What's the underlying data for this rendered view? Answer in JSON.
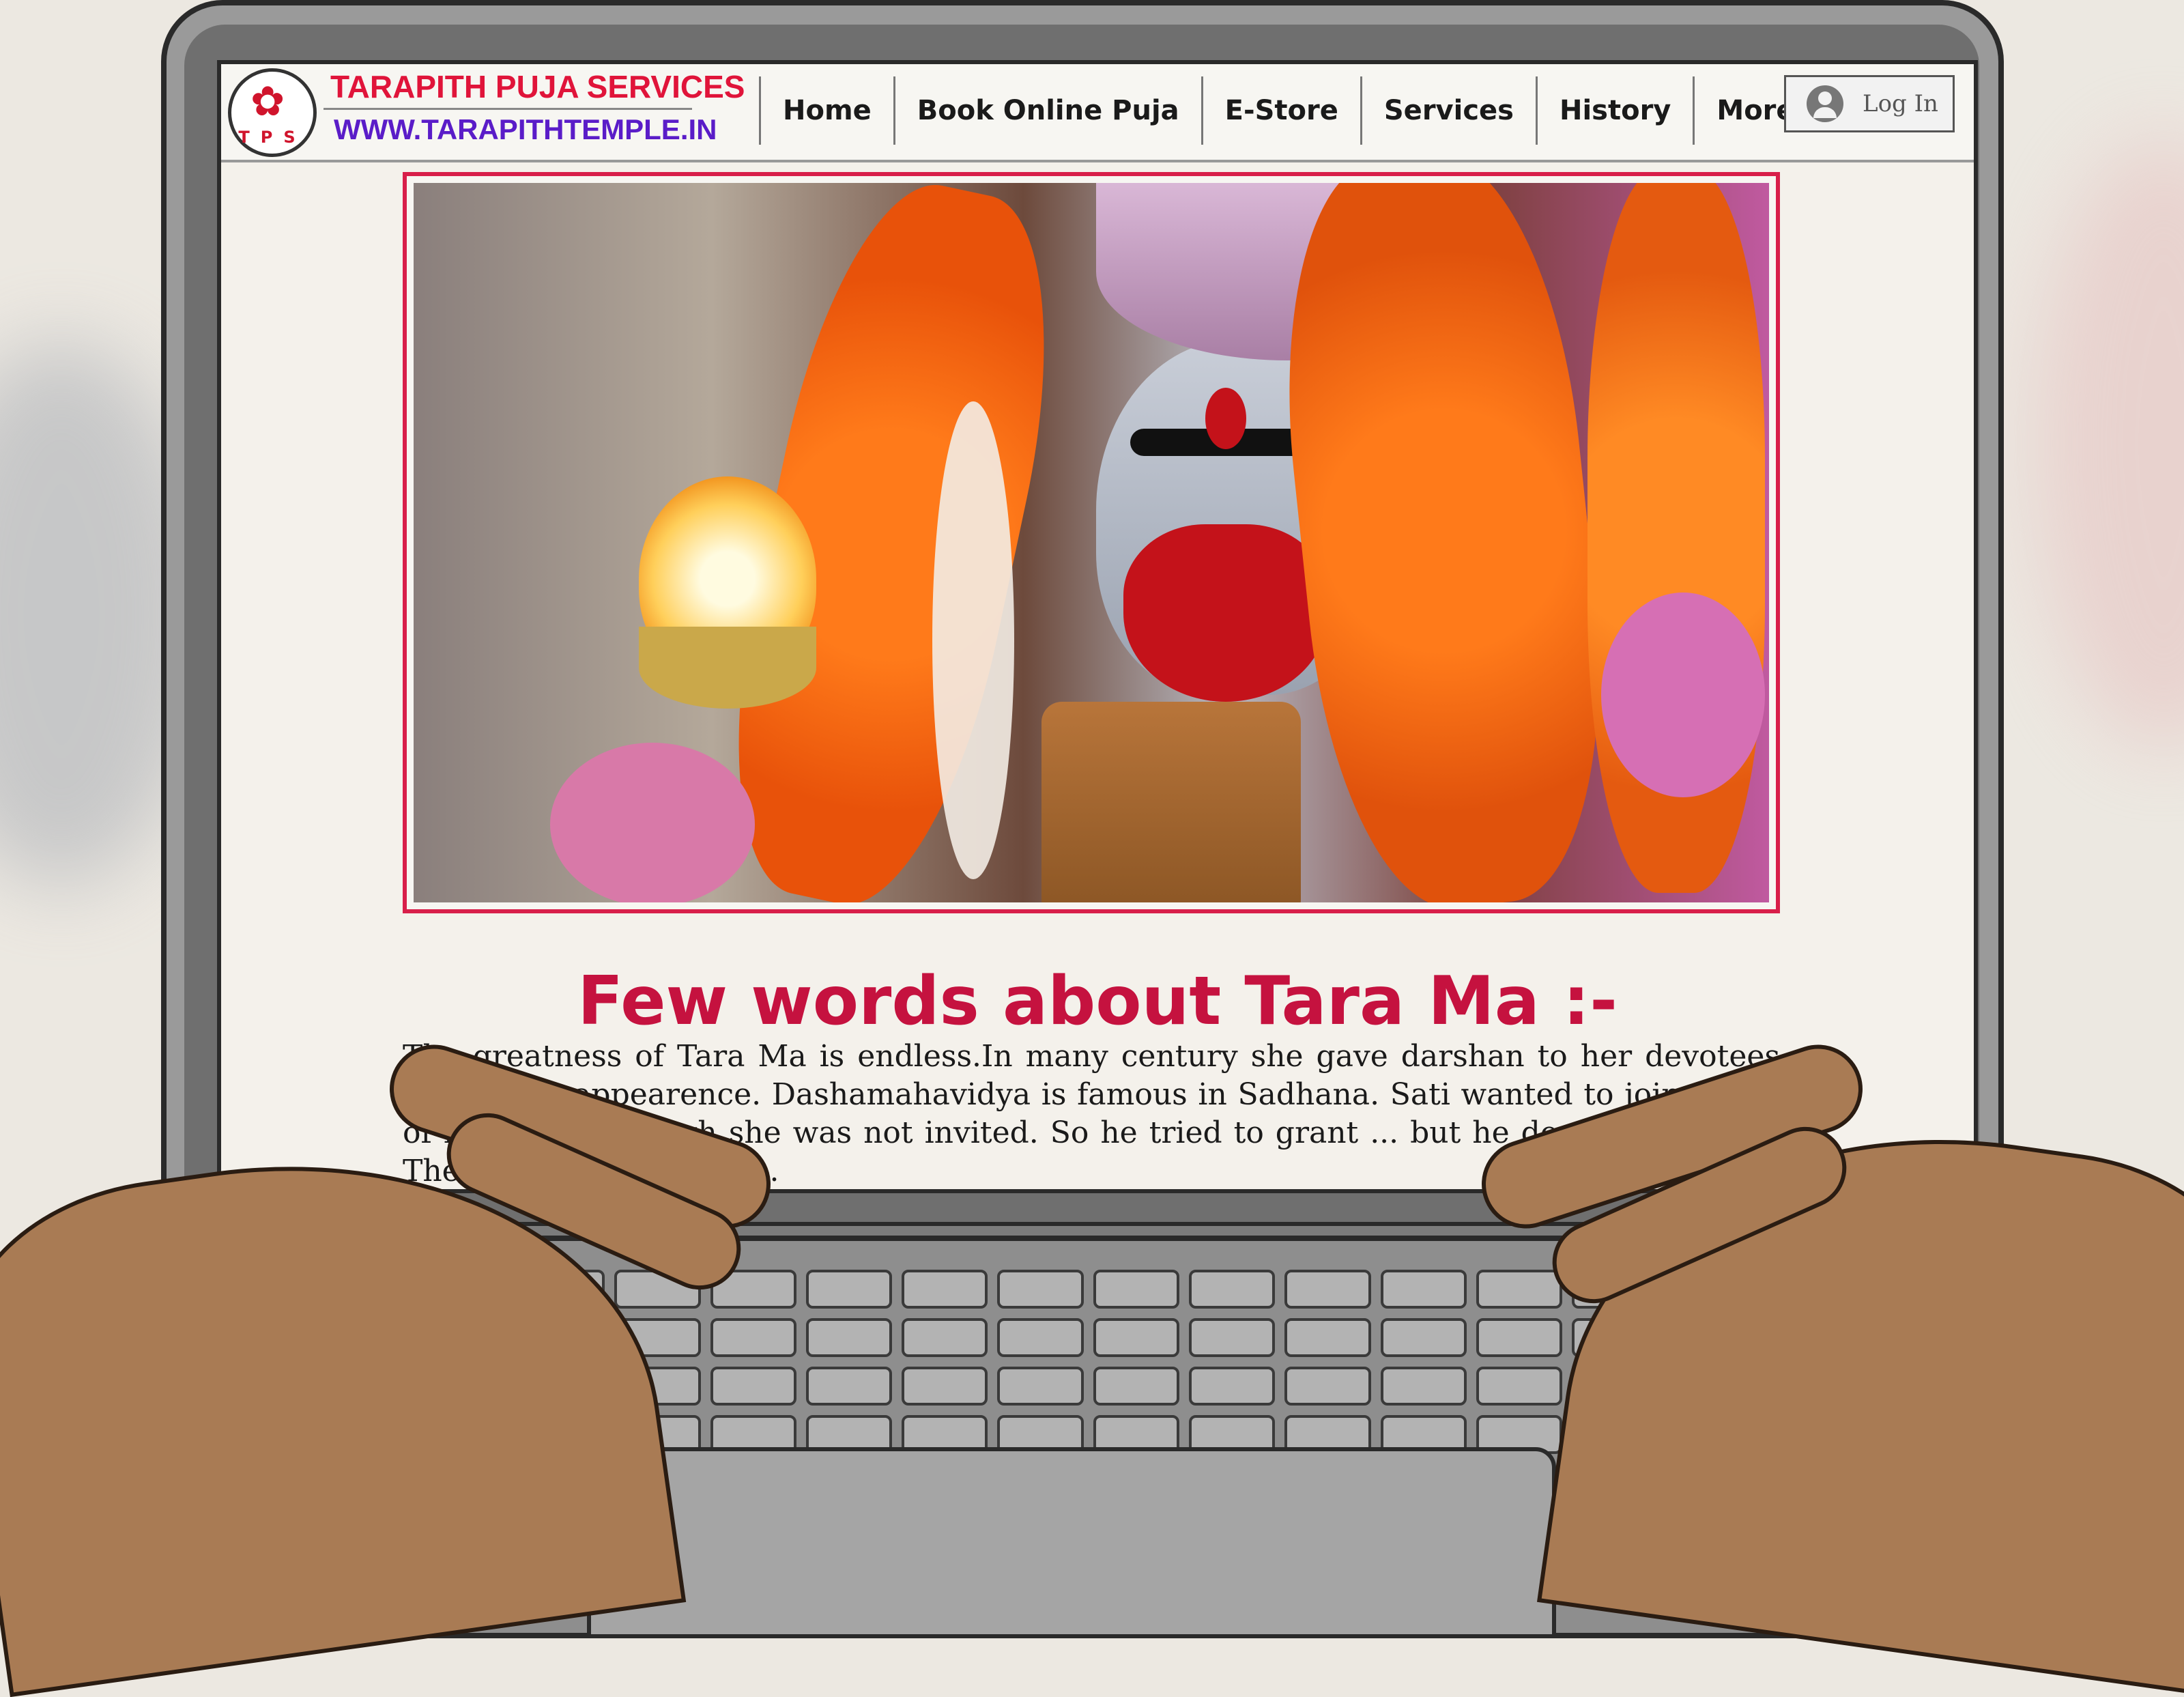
{
  "site": {
    "brand_title": "TARAPITH PUJA SERVICES",
    "brand_url": "WWW.TARAPITHTEMPLE.IN",
    "logo_initials": "TPS"
  },
  "nav": {
    "items": [
      "Home",
      "Book Online Puja",
      "E-Store",
      "Services",
      "History",
      "More"
    ]
  },
  "login": {
    "label": "Log In",
    "icon": "user-avatar-icon"
  },
  "hero": {
    "icon": "tara-ma-idol-photo",
    "frame_color": "#d81f4a"
  },
  "article": {
    "heading": "Few words about Tara Ma :-",
    "body": "The greatness of Tara Ma is endless.In many century she gave darshan to her devotees with many appearence. Dashamahavidya is famous in Sadhana. Sati wanted to join the ... of his father, though she was not invited. So he tried to grant ... but he does not agreed. Then Sati showed him ..."
  },
  "colors": {
    "accent": "#c5123f",
    "brand_red": "#e0143a",
    "brand_purple": "#5a1cc8",
    "background": "#ece8e1"
  }
}
